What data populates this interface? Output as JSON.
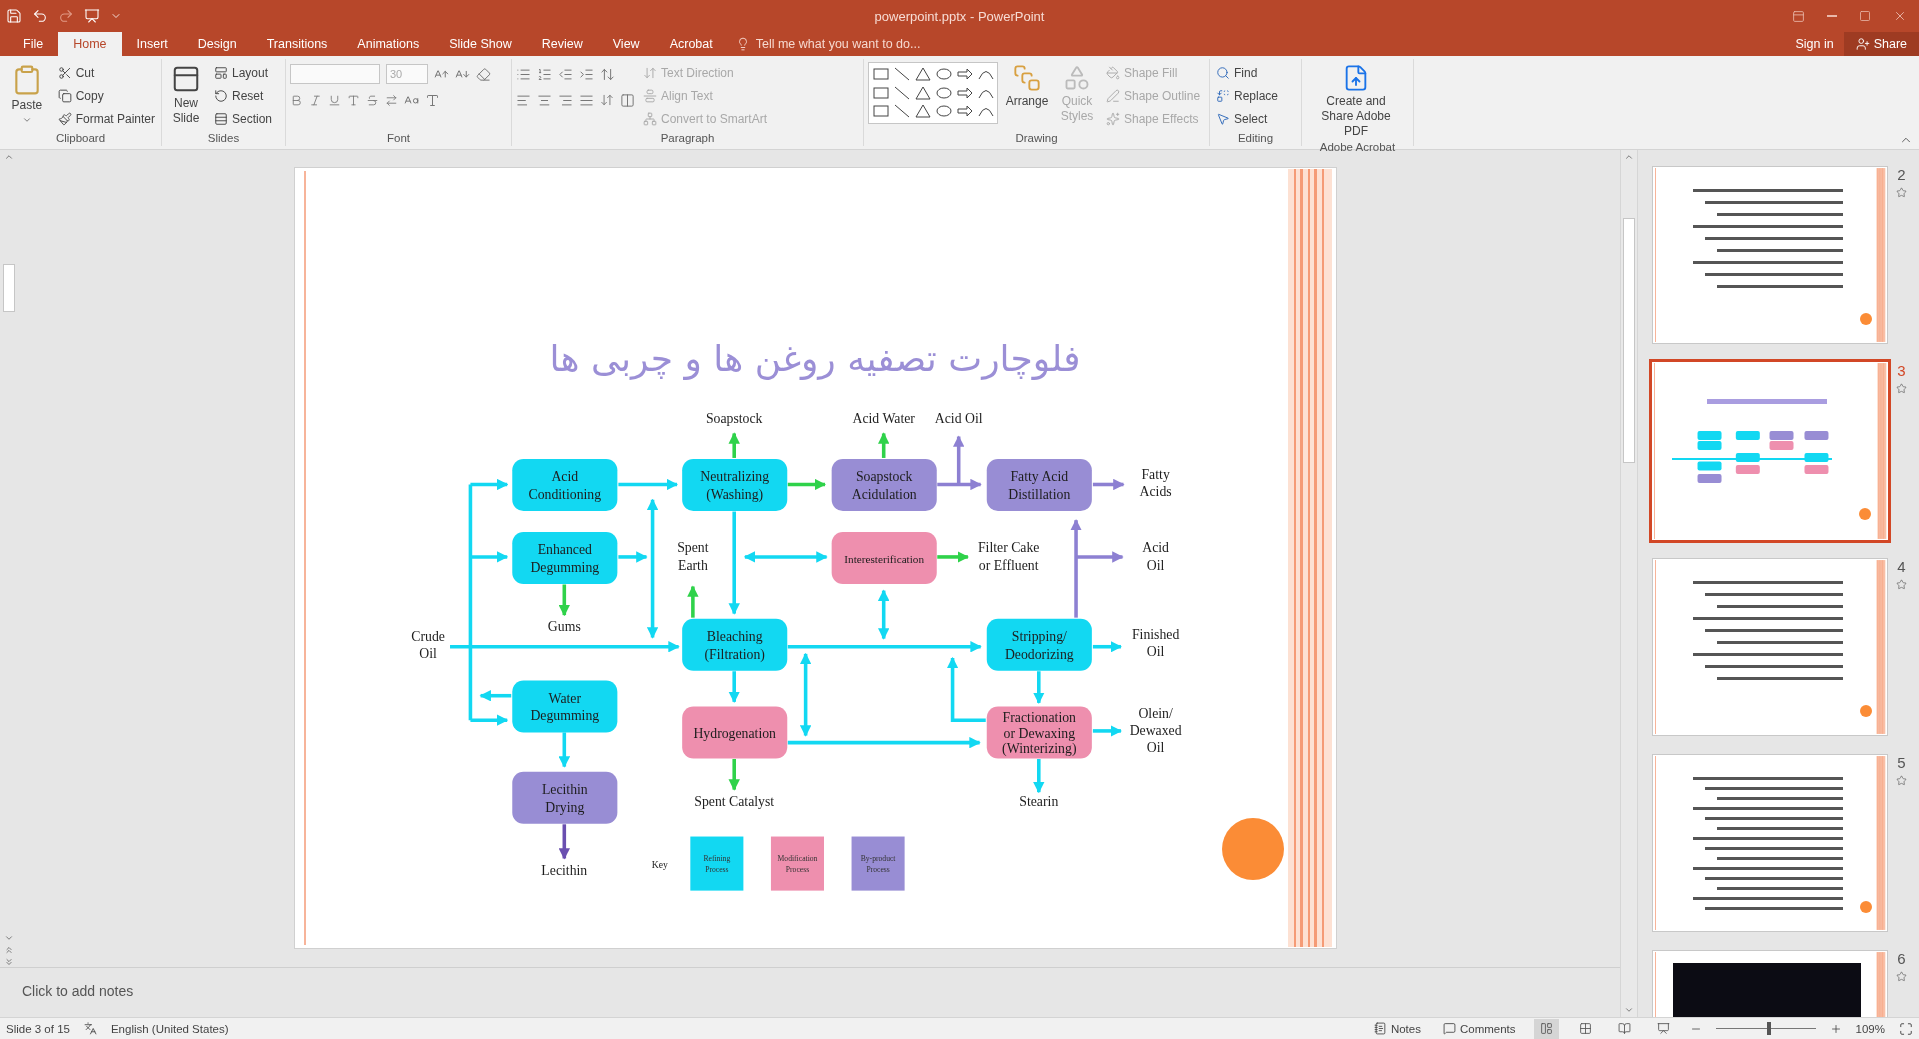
{
  "window": {
    "title": "powerpoint.pptx - PowerPoint"
  },
  "tabs": [
    {
      "label": "File",
      "selected": false
    },
    {
      "label": "Home",
      "selected": true
    },
    {
      "label": "Insert",
      "selected": false
    },
    {
      "label": "Design",
      "selected": false
    },
    {
      "label": "Transitions",
      "selected": false
    },
    {
      "label": "Animations",
      "selected": false
    },
    {
      "label": "Slide Show",
      "selected": false
    },
    {
      "label": "Review",
      "selected": false
    },
    {
      "label": "View",
      "selected": false
    },
    {
      "label": "Acrobat",
      "selected": false
    }
  ],
  "tell_me": {
    "placeholder": "Tell me what you want to do..."
  },
  "account": {
    "sign_in": "Sign in",
    "share": "Share"
  },
  "ribbon": {
    "groups": [
      {
        "kind": "clipboard",
        "label": "Clipboard",
        "main": "Paste",
        "items": [
          {
            "label": "Cut",
            "disabled": false
          },
          {
            "label": "Copy",
            "disabled": false
          },
          {
            "label": "Format Painter",
            "disabled": false
          }
        ]
      },
      {
        "kind": "slides",
        "label": "Slides",
        "main": "New Slide",
        "items": [
          {
            "label": "Layout",
            "disabled": false
          },
          {
            "label": "Reset",
            "disabled": false
          },
          {
            "label": "Section",
            "disabled": false
          }
        ]
      },
      {
        "kind": "font",
        "label": "Font",
        "font_size": "30"
      },
      {
        "kind": "paragraph",
        "label": "Paragraph",
        "items": [
          {
            "label": "Text Direction",
            "disabled": true
          },
          {
            "label": "Align Text",
            "disabled": true
          },
          {
            "label": "Convert to SmartArt",
            "disabled": true
          }
        ]
      },
      {
        "kind": "drawing",
        "label": "Drawing",
        "main": "Arrange",
        "second": "Quick Styles",
        "items": [
          {
            "label": "Shape Fill",
            "disabled": true
          },
          {
            "label": "Shape Outline",
            "disabled": true
          },
          {
            "label": "Shape Effects",
            "disabled": true
          }
        ]
      },
      {
        "kind": "editing",
        "label": "Editing",
        "items": [
          {
            "label": "Find",
            "disabled": false
          },
          {
            "label": "Replace",
            "disabled": false
          },
          {
            "label": "Select",
            "disabled": false
          }
        ]
      },
      {
        "kind": "acrobat",
        "label": "Adobe Acrobat",
        "main": "Create and Share Adobe PDF"
      }
    ]
  },
  "slide": {
    "title": "فلوچارت تصفیه روغن ها و چربی ها",
    "flowchart": {
      "nodes": [
        {
          "lines": [
            "Acid",
            "Conditioning"
          ],
          "kind": "refining"
        },
        {
          "lines": [
            "Enhanced",
            "Degumming"
          ],
          "kind": "refining"
        },
        {
          "lines": [
            "Water",
            "Degumming"
          ],
          "kind": "refining"
        },
        {
          "lines": [
            "Lecithin",
            "Drying"
          ],
          "kind": "byproduct"
        },
        {
          "lines": [
            "Neutralizing",
            "(Washing)"
          ],
          "kind": "refining"
        },
        {
          "lines": [
            "Bleaching",
            "(Filtration)"
          ],
          "kind": "refining"
        },
        {
          "lines": [
            "Hydrogenation"
          ],
          "kind": "modification"
        },
        {
          "lines": [
            "Soapstock",
            "Acidulation"
          ],
          "kind": "byproduct"
        },
        {
          "lines": [
            "Interesterification"
          ],
          "kind": "modification"
        },
        {
          "lines": [
            "Fatty Acid",
            "Distillation"
          ],
          "kind": "byproduct"
        },
        {
          "lines": [
            "Stripping/",
            "Deodorizing"
          ],
          "kind": "refining"
        },
        {
          "lines": [
            "Fractionation",
            "or Dewaxing",
            "(Winterizing)"
          ],
          "kind": "modification"
        }
      ],
      "labels": [
        {
          "lines": [
            "Soapstock"
          ]
        },
        {
          "lines": [
            "Acid Water"
          ]
        },
        {
          "lines": [
            "Acid Oil"
          ]
        },
        {
          "lines": [
            "Fatty",
            "Acids"
          ]
        },
        {
          "lines": [
            "Spent",
            "Earth"
          ]
        },
        {
          "lines": [
            "Filter Cake",
            "or Effluent"
          ]
        },
        {
          "lines": [
            "Acid",
            "Oil"
          ]
        },
        {
          "lines": [
            "Gums"
          ]
        },
        {
          "lines": [
            "Crude",
            "Oil"
          ]
        },
        {
          "lines": [
            "Finished",
            "Oil"
          ]
        },
        {
          "lines": [
            "Olein/",
            "Dewaxed",
            "Oil"
          ]
        },
        {
          "lines": [
            "Spent Catalyst"
          ]
        },
        {
          "lines": [
            "Stearin"
          ]
        },
        {
          "lines": [
            "Lecithin"
          ]
        }
      ],
      "key": {
        "label": "Key",
        "items": [
          {
            "lines": [
              "Refining",
              "Process"
            ],
            "kind": "refining"
          },
          {
            "lines": [
              "Modification",
              "Process"
            ],
            "kind": "modification"
          },
          {
            "lines": [
              "By-product",
              "Process"
            ],
            "kind": "byproduct"
          }
        ]
      }
    }
  },
  "notes": {
    "placeholder": "Click to add notes"
  },
  "thumbnails": [
    {
      "number": "2",
      "kind": "text",
      "selected": false
    },
    {
      "number": "3",
      "kind": "flowchart",
      "selected": true
    },
    {
      "number": "4",
      "kind": "text",
      "selected": false
    },
    {
      "number": "5",
      "kind": "text",
      "selected": false
    },
    {
      "number": "6",
      "kind": "photo",
      "selected": false
    }
  ],
  "status_bar": {
    "slide_info": "Slide 3 of 15",
    "language": "English (United States)",
    "notes": "Notes",
    "comments": "Comments",
    "zoom": "109%",
    "level": 0.53
  }
}
